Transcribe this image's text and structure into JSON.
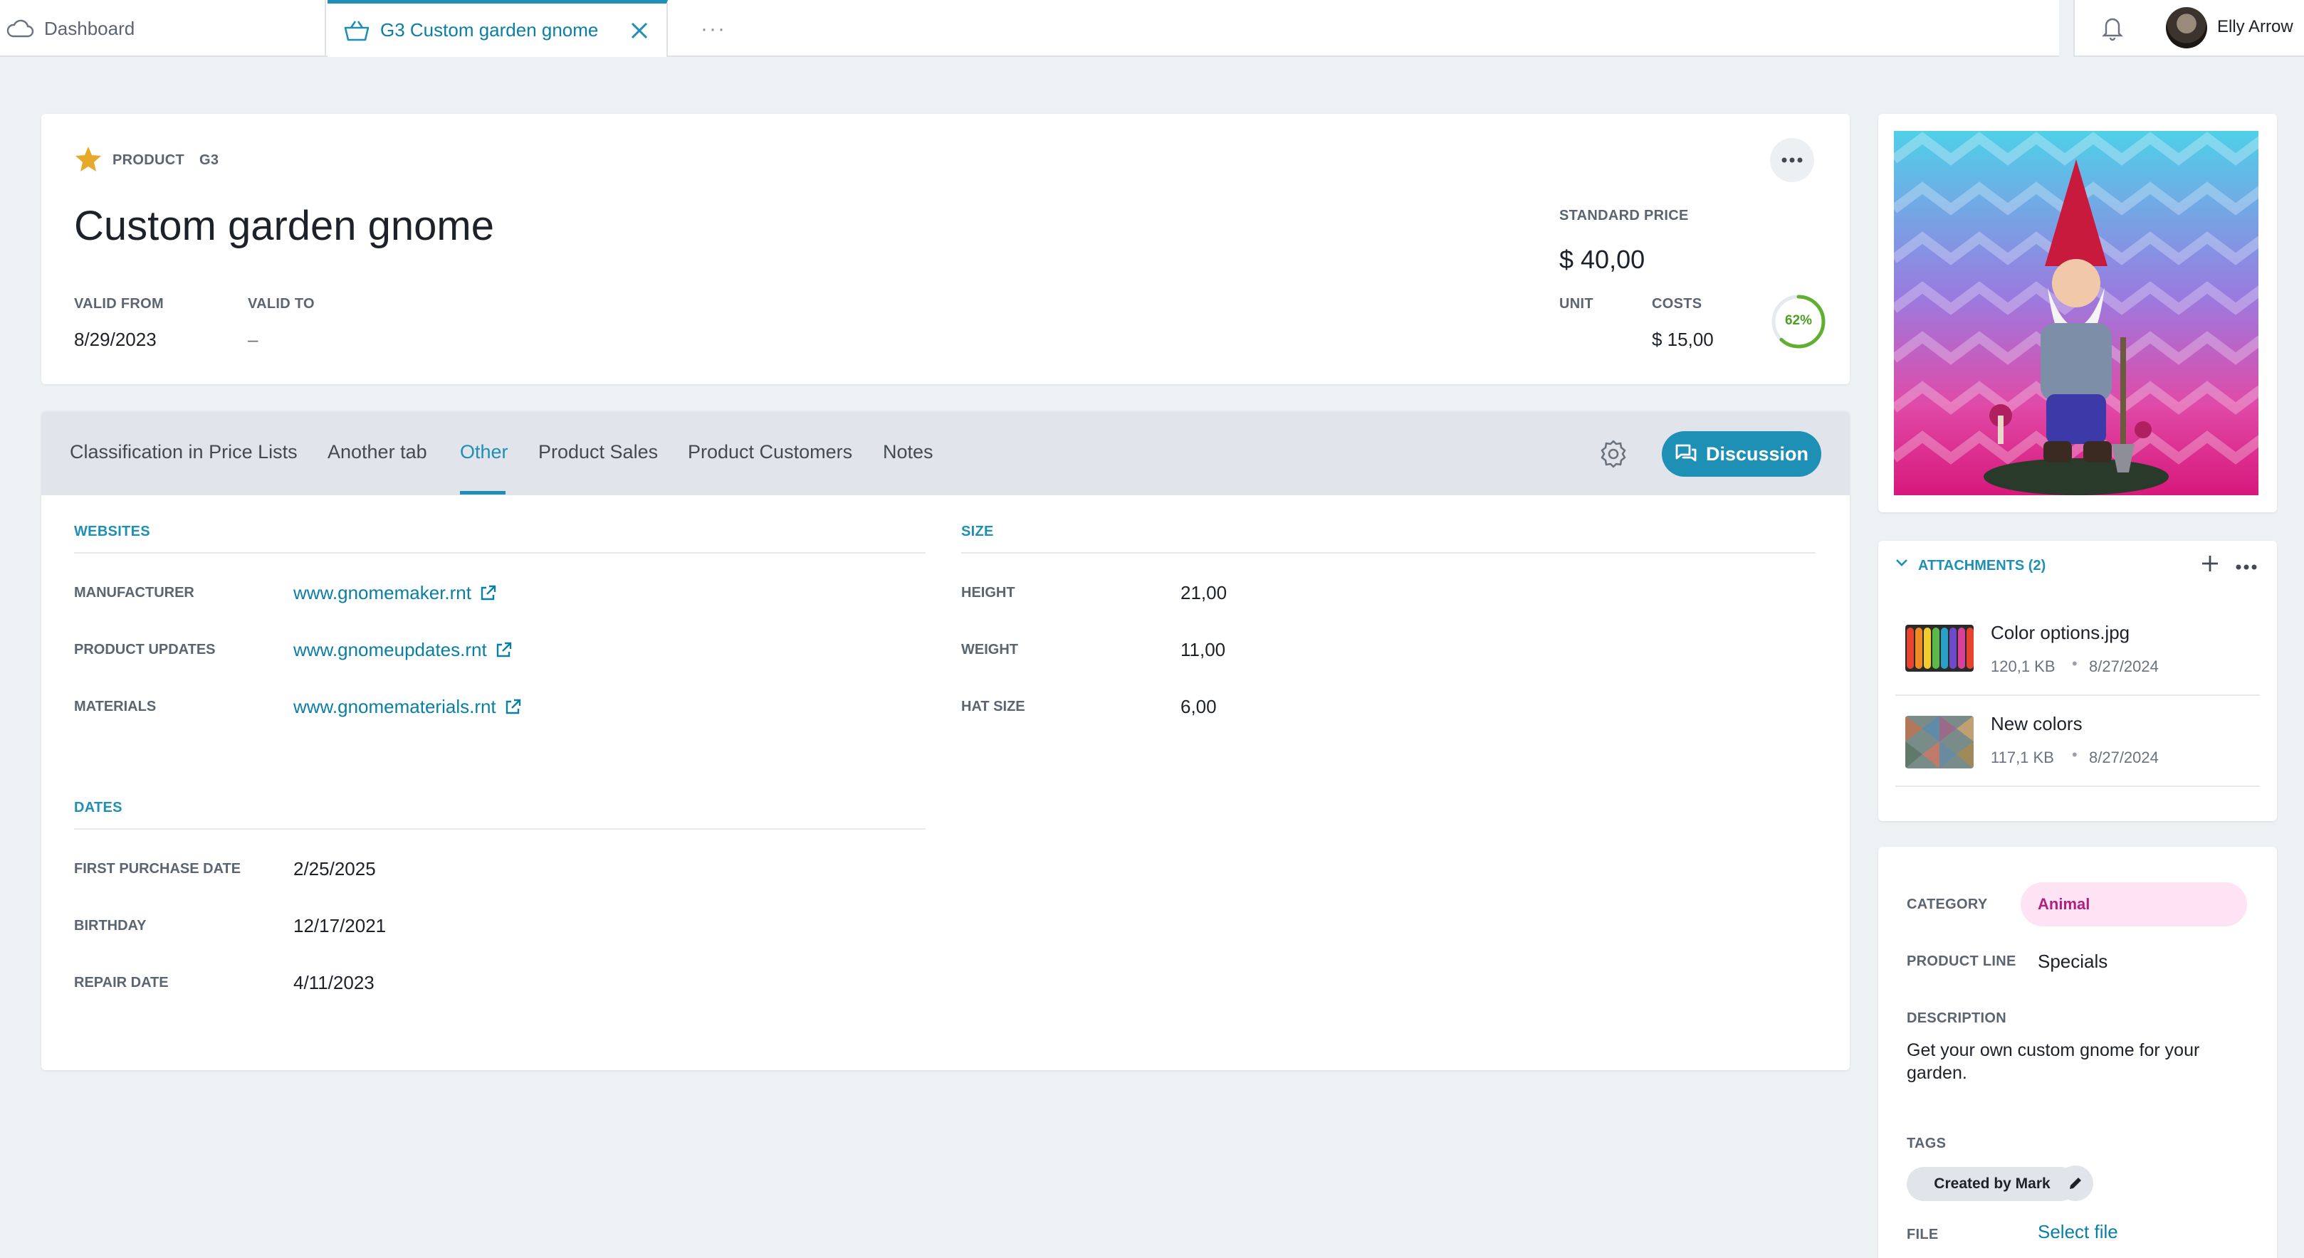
{
  "topbar": {
    "dashboard_tab": "Dashboard",
    "active_tab": "G3 Custom garden gnome",
    "more_tabs": "···",
    "user_name": "Elly Arrow"
  },
  "header": {
    "type_label": "PRODUCT",
    "code": "G3",
    "title": "Custom garden gnome",
    "valid_from_label": "VALID FROM",
    "valid_from": "8/29/2023",
    "valid_to_label": "VALID TO",
    "valid_to": "–",
    "standard_price_label": "STANDARD PRICE",
    "standard_price": "$ 40,00",
    "unit_label": "UNIT",
    "costs_label": "COSTS",
    "costs": "$ 15,00",
    "margin_percent": 62,
    "margin_text": "62%"
  },
  "tabs": {
    "items": [
      "Classification in Price Lists",
      "Another tab",
      "Other",
      "Product Sales",
      "Product Customers",
      "Notes"
    ],
    "active_index": 2,
    "discussion_label": "Discussion"
  },
  "websites": {
    "title": "WEBSITES",
    "rows": [
      {
        "label": "MANUFACTURER",
        "value": "www.gnomemaker.rnt"
      },
      {
        "label": "PRODUCT UPDATES",
        "value": "www.gnomeupdates.rnt"
      },
      {
        "label": "MATERIALS",
        "value": "www.gnomematerials.rnt"
      }
    ]
  },
  "size": {
    "title": "SIZE",
    "rows": [
      {
        "label": "HEIGHT",
        "value": "21,00"
      },
      {
        "label": "WEIGHT",
        "value": "11,00"
      },
      {
        "label": "HAT SIZE",
        "value": "6,00"
      }
    ]
  },
  "dates": {
    "title": "DATES",
    "rows": [
      {
        "label": "FIRST PURCHASE DATE",
        "value": "2/25/2025"
      },
      {
        "label": "BIRTHDAY",
        "value": "12/17/2021"
      },
      {
        "label": "REPAIR DATE",
        "value": "4/11/2023"
      }
    ]
  },
  "attachments": {
    "title": "ATTACHMENTS (2)",
    "items": [
      {
        "name": "Color options.jpg",
        "size": "120,1 KB",
        "date": "8/27/2024"
      },
      {
        "name": "New colors",
        "size": "117,1 KB",
        "date": "8/27/2024"
      }
    ]
  },
  "info": {
    "category_label": "CATEGORY",
    "category": "Animal",
    "product_line_label": "PRODUCT LINE",
    "product_line": "Specials",
    "description_label": "DESCRIPTION",
    "description": "Get your own custom gnome for your garden.",
    "tags_label": "TAGS",
    "tag": "Created by Mark",
    "file_label": "FILE",
    "file_action": "Select file"
  },
  "colors": {
    "accent": "#1e8fb5",
    "category_bg": "#fde3f4",
    "category_text": "#b0217f",
    "progress": "#5fb030"
  }
}
